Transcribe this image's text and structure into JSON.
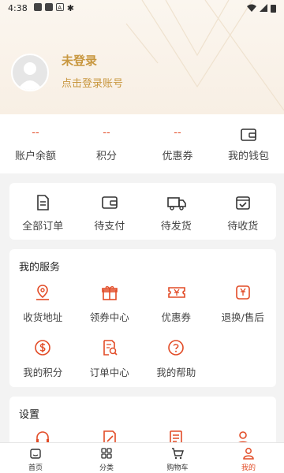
{
  "status_bar": {
    "time": "4:38"
  },
  "user": {
    "name": "未登录",
    "login_prompt": "点击登录账号"
  },
  "stats": [
    {
      "value": "--",
      "label": "账户余额"
    },
    {
      "value": "--",
      "label": "积分"
    },
    {
      "value": "--",
      "label": "优惠券"
    }
  ],
  "wallet": {
    "label": "我的钱包",
    "icon": "wallet-icon"
  },
  "orders": [
    {
      "label": "全部订单",
      "icon": "order-list-icon"
    },
    {
      "label": "待支付",
      "icon": "wallet-icon"
    },
    {
      "label": "待发货",
      "icon": "truck-icon"
    },
    {
      "label": "待收货",
      "icon": "box-check-icon"
    }
  ],
  "services": {
    "title": "我的服务",
    "items": [
      {
        "label": "收货地址",
        "icon": "location-icon"
      },
      {
        "label": "领券中心",
        "icon": "gift-icon"
      },
      {
        "label": "优惠券",
        "icon": "coupon-icon"
      },
      {
        "label": "退换/售后",
        "icon": "refund-icon"
      },
      {
        "label": "我的积分",
        "icon": "points-icon"
      },
      {
        "label": "订单中心",
        "icon": "order-search-icon"
      },
      {
        "label": "我的帮助",
        "icon": "help-icon"
      }
    ]
  },
  "settings": {
    "title": "设置"
  },
  "tabs": [
    {
      "label": "首页",
      "icon": "home-icon",
      "active": false
    },
    {
      "label": "分类",
      "icon": "category-icon",
      "active": false
    },
    {
      "label": "购物车",
      "icon": "cart-icon",
      "active": false
    },
    {
      "label": "我的",
      "icon": "profile-icon",
      "active": true
    }
  ],
  "colors": {
    "accent": "#e24b26",
    "gold": "#c8973f",
    "header_bg": "#f8efe4"
  }
}
